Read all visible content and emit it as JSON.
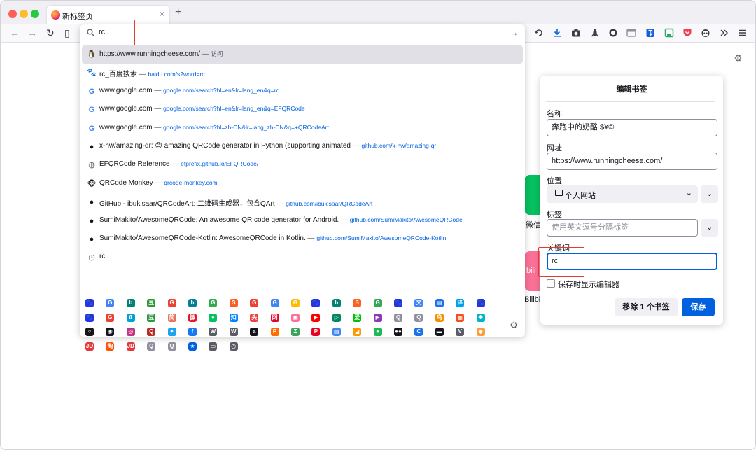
{
  "window": {
    "tab_title": "新标签页",
    "tab_close": "×",
    "new_tab": "+"
  },
  "nav": {
    "back": "←",
    "forward": "→",
    "reload": "↻",
    "sidebar": "▯"
  },
  "toolbar_icons": [
    "undo-icon",
    "download-icon",
    "screenshot-icon",
    "rocket-icon",
    "circle-icon",
    "container-icon",
    "bitwarden-icon",
    "save-icon",
    "pocket-icon",
    "panda-icon",
    "overflow-icon",
    "menu-icon"
  ],
  "urlbar": {
    "value": "rc",
    "go": "→"
  },
  "results": [
    {
      "icon": "runningcheese-icon",
      "title": "https://www.runningcheese.com/",
      "sep": " — ",
      "url": "",
      "action": "访问",
      "selected": true
    },
    {
      "icon": "baidu-icon",
      "title": "rc_百度搜索",
      "sep": " — ",
      "url": "baidu.com/s?word=rc",
      "action": ""
    },
    {
      "icon": "google-icon",
      "title": "www.google.com",
      "sep": " — ",
      "url": "google.com/search?hl=en&lr=lang_en&q=rc",
      "action": ""
    },
    {
      "icon": "google-icon",
      "title": "www.google.com",
      "sep": " — ",
      "url": "google.com/search?hl=en&lr=lang_en&q=EFQRCode",
      "action": ""
    },
    {
      "icon": "google-icon",
      "title": "www.google.com",
      "sep": " — ",
      "url": "google.com/search?hl=zh-CN&lr=lang_zh-CN&q=+QRCodeArt",
      "action": ""
    },
    {
      "icon": "github-icon",
      "title": "x-hw/amazing-qr: 😊 amazing QRCode generator in Python (supporting animated",
      "sep": " — ",
      "url": "github.com/x-hw/amazing-qr",
      "action": ""
    },
    {
      "icon": "globe-icon",
      "title": "EFQRCode Reference",
      "sep": " — ",
      "url": "efprefix.github.io/EFQRCode/",
      "action": ""
    },
    {
      "icon": "qrcode-monkey-icon",
      "title": "QRCode Monkey",
      "sep": " — ",
      "url": "qrcode-monkey.com",
      "action": ""
    },
    {
      "icon": "github-icon",
      "title": "GitHub - ibukisaar/QRCodeArt: 二维码生成器，包含QArt",
      "sep": " — ",
      "url": "github.com/ibukisaar/QRCodeArt",
      "action": ""
    },
    {
      "icon": "github-icon",
      "title": "SumiMakito/AwesomeQRCode: An awesome QR code generator for Android.",
      "sep": " — ",
      "url": "github.com/SumiMakito/AwesomeQRCode",
      "action": ""
    },
    {
      "icon": "github-icon",
      "title": "SumiMakito/AwesomeQRCode-Kotlin: AwesomeQRCode in Kotlin.",
      "sep": " — ",
      "url": "github.com/SumiMakito/AwesomeQRCode-Kotlin",
      "action": ""
    },
    {
      "icon": "history-icon",
      "title": "rc",
      "sep": "",
      "url": "",
      "action": ""
    }
  ],
  "engines": [
    [
      {
        "n": "baidu",
        "c": "#2932e1",
        "g": "🐾"
      },
      {
        "n": "google",
        "c": "#4285f4",
        "g": "G"
      },
      {
        "n": "bing",
        "c": "#008373",
        "g": "b"
      },
      {
        "n": "douban",
        "c": "#2e963d",
        "g": "豆"
      },
      {
        "n": "google",
        "c": "#ea4335",
        "g": "G"
      },
      {
        "n": "bing",
        "c": "#00809d",
        "g": "b"
      },
      {
        "n": "google",
        "c": "#34a853",
        "g": "G"
      },
      {
        "n": "sogou",
        "c": "#fb6022",
        "g": "S"
      },
      {
        "n": "google",
        "c": "#ea4335",
        "g": "G"
      },
      {
        "n": "google",
        "c": "#4285f4",
        "g": "G"
      },
      {
        "n": "google",
        "c": "#fbbc05",
        "g": "G"
      },
      {
        "n": "baidu",
        "c": "#2932e1",
        "g": "🐾"
      },
      {
        "n": "bing",
        "c": "#008373",
        "g": "b"
      },
      {
        "n": "sogou",
        "c": "#fb6022",
        "g": "S"
      },
      {
        "n": "google",
        "c": "#34a853",
        "g": "G"
      },
      {
        "n": "baidu",
        "c": "#2932e1",
        "g": "🐾"
      },
      {
        "n": "translate",
        "c": "#4285f4",
        "g": "文"
      },
      {
        "n": "doc",
        "c": "#1a73e8",
        "g": "▤"
      },
      {
        "n": "translate",
        "c": "#00a0e9",
        "g": "译"
      },
      {
        "n": "baidu",
        "c": "#2932e1",
        "g": "🐾"
      }
    ],
    [
      {
        "n": "baidu",
        "c": "#2932e1",
        "g": "🐾"
      },
      {
        "n": "google",
        "c": "#ea4335",
        "g": "G"
      },
      {
        "n": "bilibili",
        "c": "#00a1d6",
        "g": "ß"
      },
      {
        "n": "douban",
        "c": "#2e963d",
        "g": "豆"
      },
      {
        "n": "jianshu",
        "c": "#ea6f5a",
        "g": "简"
      },
      {
        "n": "weibo",
        "c": "#e6162d",
        "g": "微"
      },
      {
        "n": "wechat",
        "c": "#07c160",
        "g": "●"
      },
      {
        "n": "zhihu",
        "c": "#0084ff",
        "g": "知"
      },
      {
        "n": "toutiao",
        "c": "#f04142",
        "g": "头"
      },
      {
        "n": "netease",
        "c": "#e60026",
        "g": "网"
      },
      {
        "n": "bilibili",
        "c": "#fb7299",
        "g": "▣"
      },
      {
        "n": "youtube",
        "c": "#ff0000",
        "g": "▶"
      },
      {
        "n": "play",
        "c": "#01875f",
        "g": "▷"
      },
      {
        "n": "iqiyi",
        "c": "#00be06",
        "g": "爱"
      },
      {
        "n": "play",
        "c": "#8a3ab9",
        "g": "▶"
      },
      {
        "n": "search",
        "c": "#8f8f9d",
        "g": "Q"
      },
      {
        "n": "search",
        "c": "#8f8f9d",
        "g": "Q"
      },
      {
        "n": "bird",
        "c": "#f29100",
        "g": "鸟"
      },
      {
        "n": "microsoft",
        "c": "#f25022",
        "g": "▦"
      },
      {
        "n": "puzzle",
        "c": "#00b4cc",
        "g": "✚"
      }
    ],
    [
      {
        "n": "github",
        "c": "#15141a",
        "g": "○"
      },
      {
        "n": "maps",
        "c": "#15141a",
        "g": "◉"
      },
      {
        "n": "instagram",
        "c": "#c13584",
        "g": "◎"
      },
      {
        "n": "quora",
        "c": "#b92b27",
        "g": "Q"
      },
      {
        "n": "twitter",
        "c": "#1da1f2",
        "g": "✦"
      },
      {
        "n": "facebook",
        "c": "#1877f2",
        "g": "f"
      },
      {
        "n": "wikipedia",
        "c": "#5b5b66",
        "g": "W"
      },
      {
        "n": "wikipedia",
        "c": "#5b5b66",
        "g": "W"
      },
      {
        "n": "amazon",
        "c": "#15141a",
        "g": "a"
      },
      {
        "n": "png",
        "c": "#ff6d00",
        "g": "P"
      },
      {
        "n": "zcool",
        "c": "#3ca45c",
        "g": "Z"
      },
      {
        "n": "pinterest",
        "c": "#e60023",
        "g": "P"
      },
      {
        "n": "document",
        "c": "#4285f4",
        "g": "▤"
      },
      {
        "n": "rainbow",
        "c": "#ff9800",
        "g": "◢"
      },
      {
        "n": "spotify",
        "c": "#1db954",
        "g": "●"
      },
      {
        "n": "medium",
        "c": "#15141a",
        "g": "●●"
      },
      {
        "n": "chrome",
        "c": "#1a73e8",
        "g": "C"
      },
      {
        "n": "screen",
        "c": "#15141a",
        "g": "▬"
      },
      {
        "n": "vue",
        "c": "#5b5b66",
        "g": "V"
      },
      {
        "n": "gitlab",
        "c": "#f9a03c",
        "g": "◆"
      }
    ],
    [
      {
        "n": "jd",
        "c": "#e4393c",
        "g": "JD"
      },
      {
        "n": "taobao",
        "c": "#ff5000",
        "g": "淘"
      },
      {
        "n": "jd",
        "c": "#e4393c",
        "g": "JD"
      },
      {
        "n": "search",
        "c": "#8f8f9d",
        "g": "Q"
      },
      {
        "n": "search",
        "c": "#8f8f9d",
        "g": "Q"
      },
      {
        "n": "bookmark",
        "c": "#0061e0",
        "g": "★"
      },
      {
        "n": "tabs",
        "c": "#5b5b66",
        "g": "▭"
      },
      {
        "n": "history",
        "c": "#5b5b66",
        "g": "◷"
      }
    ]
  ],
  "engines_settings": "⚙",
  "page": {
    "settings": "⚙",
    "wechat_label": "微信",
    "bili_label": "Bilibili",
    "bili_logo": "bili"
  },
  "bookmark_panel": {
    "title": "编辑书签",
    "name_label": "名称",
    "name_value": "奔跑中的奶酪 $¥©",
    "url_label": "网址",
    "url_value": "https://www.runningcheese.com/",
    "location_label": "位置",
    "location_value": "个人网站",
    "tags_label": "标签",
    "tags_placeholder": "使用英文逗号分隔标签",
    "keyword_label": "关键词",
    "keyword_value": "rc",
    "show_editor_label": "保存时显示编辑器",
    "remove_button": "移除 1 个书签",
    "save_button": "保存",
    "chevron": "⌄"
  }
}
